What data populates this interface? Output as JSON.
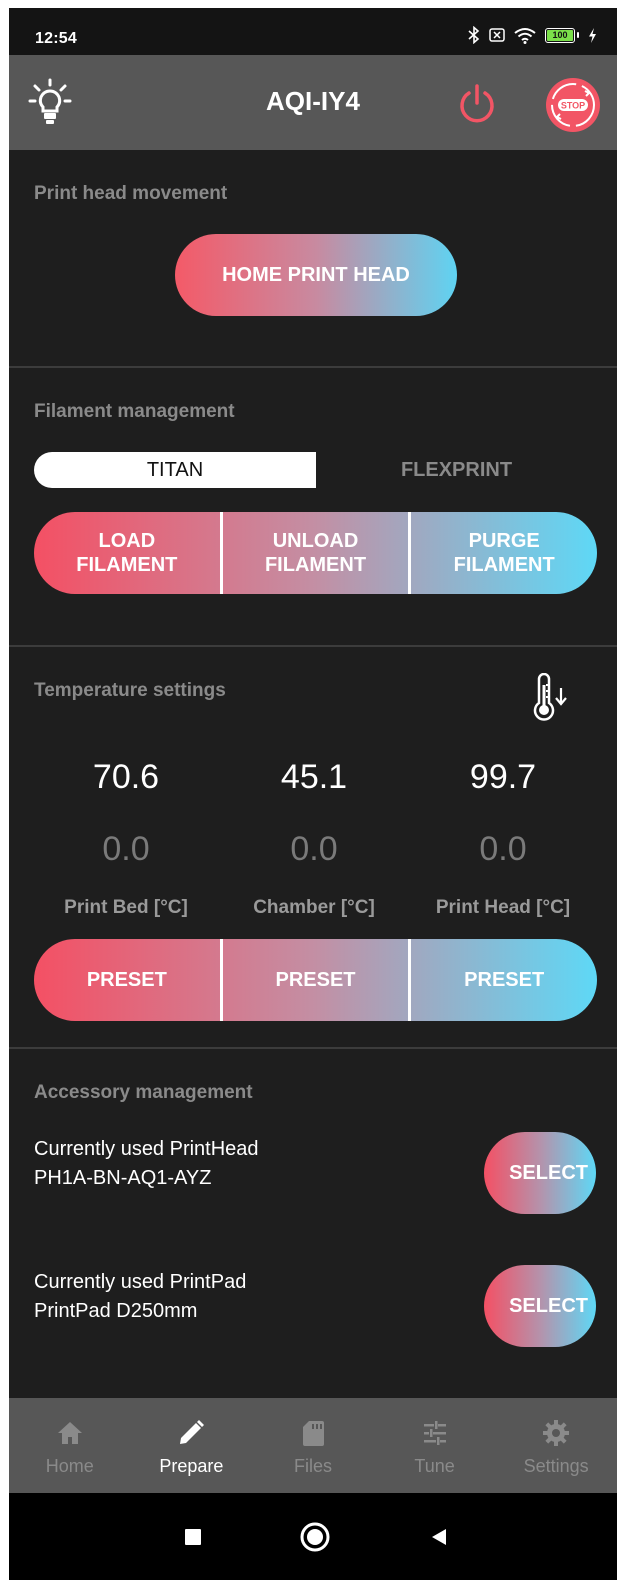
{
  "status_bar": {
    "time": "12:54",
    "battery": "100",
    "icons": [
      "bluetooth-icon",
      "sim-off-icon",
      "wifi-icon",
      "battery-icon",
      "charging-icon"
    ]
  },
  "app_bar": {
    "title": "AQI-IY4",
    "icons": [
      "light-bulb-icon",
      "power-icon",
      "emergency-stop-icon"
    ],
    "stop_label": "STOP"
  },
  "print_head_movement": {
    "title": "Print head movement",
    "home_button": "HOME PRINT HEAD"
  },
  "filament_management": {
    "title": "Filament management",
    "tabs": [
      {
        "label": "TITAN",
        "selected": true
      },
      {
        "label": "FLEXPRINT",
        "selected": false
      }
    ],
    "buttons": [
      {
        "label": "LOAD\nFILAMENT"
      },
      {
        "label": "UNLOAD\nFILAMENT"
      },
      {
        "label": "PURGE\nFILAMENT"
      }
    ]
  },
  "temperature_settings": {
    "title": "Temperature settings",
    "icon": "thermometer-cooldown-icon",
    "columns": [
      {
        "actual": "70.6",
        "target": "0.0",
        "label": "Print Bed [°C]",
        "preset": "PRESET"
      },
      {
        "actual": "45.1",
        "target": "0.0",
        "label": "Chamber [°C]",
        "preset": "PRESET"
      },
      {
        "actual": "99.7",
        "target": "0.0",
        "label": "Print Head [°C]",
        "preset": "PRESET"
      }
    ]
  },
  "accessory_management": {
    "title": "Accessory management",
    "items": [
      {
        "label": "Currently used PrintHead",
        "value": "PH1A-BN-AQ1-AYZ",
        "button": "SELECT"
      },
      {
        "label": "Currently used PrintPad",
        "value": "PrintPad D250mm",
        "button": "SELECT"
      }
    ]
  },
  "bottom_nav": {
    "items": [
      {
        "label": "Home",
        "icon": "home-icon",
        "active": false
      },
      {
        "label": "Prepare",
        "icon": "pencil-icon",
        "active": true
      },
      {
        "label": "Files",
        "icon": "sd-card-icon",
        "active": false
      },
      {
        "label": "Tune",
        "icon": "sliders-icon",
        "active": false
      },
      {
        "label": "Settings",
        "icon": "gear-icon",
        "active": false
      }
    ]
  },
  "colors": {
    "gradient_start": "#f45064",
    "gradient_end": "#5ed8f6",
    "background": "#1e1e1e",
    "bar": "#575757",
    "accent_red": "#f25565"
  }
}
